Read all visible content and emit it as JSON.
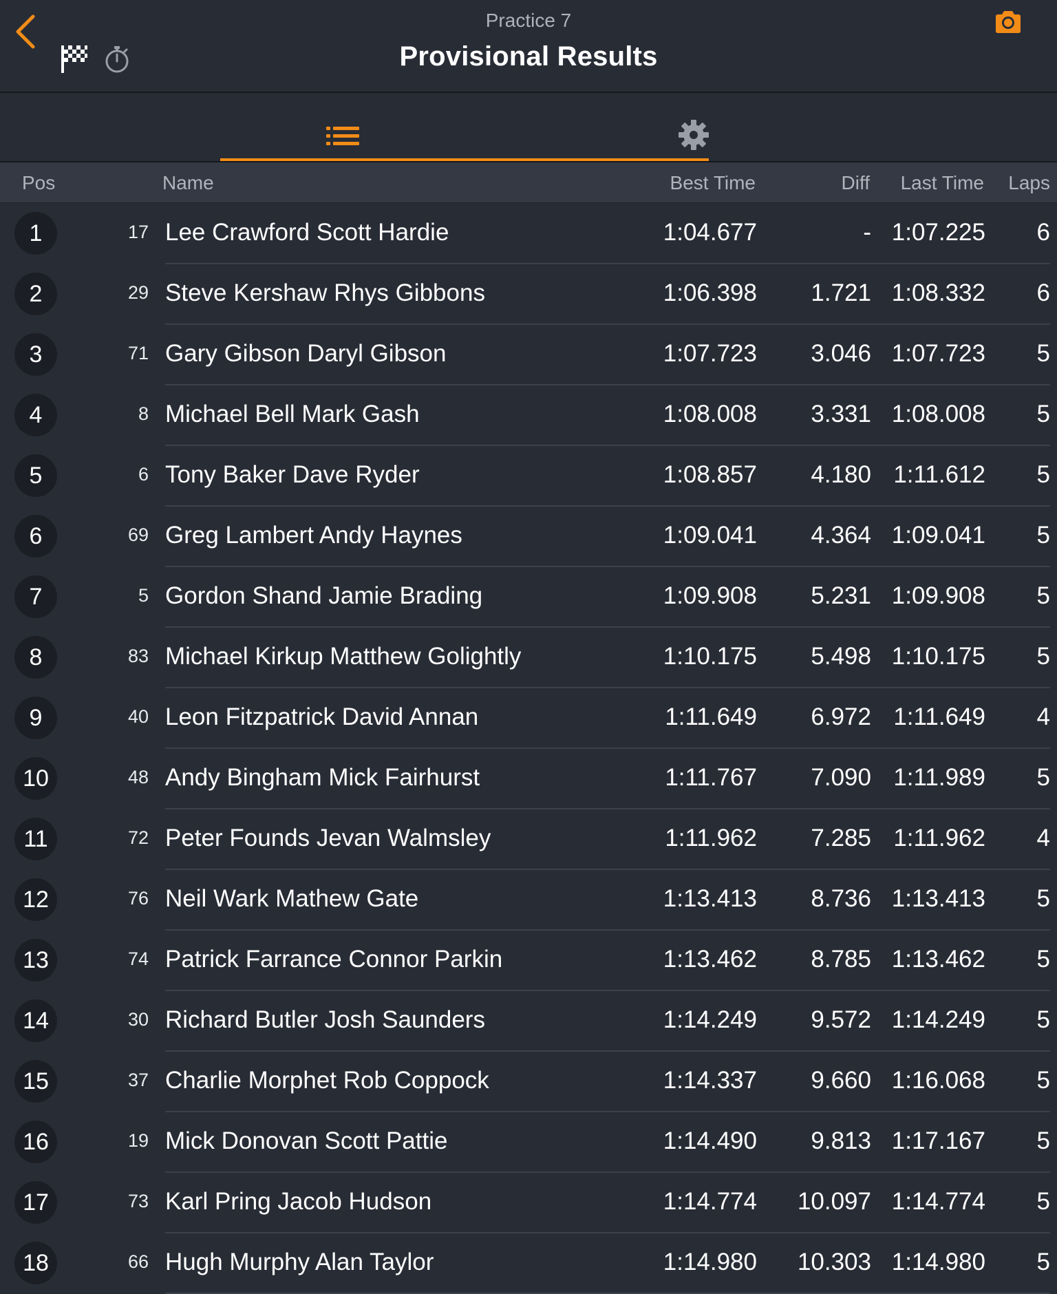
{
  "header": {
    "subtitle": "Practice 7",
    "title": "Provisional Results",
    "back_icon": "chevron-left-icon",
    "flag_icon": "checkered-flag-icon",
    "stopwatch_icon": "stopwatch-icon",
    "camera_icon": "camera-icon"
  },
  "tabs": [
    {
      "icon": "list-icon",
      "active": true
    },
    {
      "icon": "gear-icon",
      "active": false
    }
  ],
  "columns": {
    "pos": "Pos",
    "name": "Name",
    "best_time": "Best Time",
    "diff": "Diff",
    "last_time": "Last Time",
    "laps": "Laps"
  },
  "colors": {
    "accent": "#f28c17",
    "background": "#282c35",
    "header_row": "#343944",
    "badge": "#1b1e24"
  },
  "results": [
    {
      "pos": "1",
      "num": "17",
      "name": "Lee Crawford Scott Hardie",
      "best": "1:04.677",
      "diff": "-",
      "last": "1:07.225",
      "laps": "6"
    },
    {
      "pos": "2",
      "num": "29",
      "name": "Steve Kershaw Rhys Gibbons",
      "best": "1:06.398",
      "diff": "1.721",
      "last": "1:08.332",
      "laps": "6"
    },
    {
      "pos": "3",
      "num": "71",
      "name": "Gary Gibson Daryl Gibson",
      "best": "1:07.723",
      "diff": "3.046",
      "last": "1:07.723",
      "laps": "5"
    },
    {
      "pos": "4",
      "num": "8",
      "name": "Michael Bell Mark Gash",
      "best": "1:08.008",
      "diff": "3.331",
      "last": "1:08.008",
      "laps": "5"
    },
    {
      "pos": "5",
      "num": "6",
      "name": "Tony Baker Dave Ryder",
      "best": "1:08.857",
      "diff": "4.180",
      "last": "1:11.612",
      "laps": "5"
    },
    {
      "pos": "6",
      "num": "69",
      "name": "Greg Lambert Andy Haynes",
      "best": "1:09.041",
      "diff": "4.364",
      "last": "1:09.041",
      "laps": "5"
    },
    {
      "pos": "7",
      "num": "5",
      "name": "Gordon Shand Jamie Brading",
      "best": "1:09.908",
      "diff": "5.231",
      "last": "1:09.908",
      "laps": "5"
    },
    {
      "pos": "8",
      "num": "83",
      "name": "Michael Kirkup Matthew Golightly",
      "best": "1:10.175",
      "diff": "5.498",
      "last": "1:10.175",
      "laps": "5"
    },
    {
      "pos": "9",
      "num": "40",
      "name": "Leon Fitzpatrick David Annan",
      "best": "1:11.649",
      "diff": "6.972",
      "last": "1:11.649",
      "laps": "4"
    },
    {
      "pos": "10",
      "num": "48",
      "name": "Andy Bingham Mick Fairhurst",
      "best": "1:11.767",
      "diff": "7.090",
      "last": "1:11.989",
      "laps": "5"
    },
    {
      "pos": "11",
      "num": "72",
      "name": "Peter Founds Jevan Walmsley",
      "best": "1:11.962",
      "diff": "7.285",
      "last": "1:11.962",
      "laps": "4"
    },
    {
      "pos": "12",
      "num": "76",
      "name": "Neil Wark Mathew Gate",
      "best": "1:13.413",
      "diff": "8.736",
      "last": "1:13.413",
      "laps": "5"
    },
    {
      "pos": "13",
      "num": "74",
      "name": "Patrick Farrance Connor Parkin",
      "best": "1:13.462",
      "diff": "8.785",
      "last": "1:13.462",
      "laps": "5"
    },
    {
      "pos": "14",
      "num": "30",
      "name": "Richard Butler Josh Saunders",
      "best": "1:14.249",
      "diff": "9.572",
      "last": "1:14.249",
      "laps": "5"
    },
    {
      "pos": "15",
      "num": "37",
      "name": "Charlie Morphet Rob Coppock",
      "best": "1:14.337",
      "diff": "9.660",
      "last": "1:16.068",
      "laps": "5"
    },
    {
      "pos": "16",
      "num": "19",
      "name": "Mick Donovan Scott Pattie",
      "best": "1:14.490",
      "diff": "9.813",
      "last": "1:17.167",
      "laps": "5"
    },
    {
      "pos": "17",
      "num": "73",
      "name": "Karl Pring Jacob Hudson",
      "best": "1:14.774",
      "diff": "10.097",
      "last": "1:14.774",
      "laps": "5"
    },
    {
      "pos": "18",
      "num": "66",
      "name": "Hugh Murphy Alan Taylor",
      "best": "1:14.980",
      "diff": "10.303",
      "last": "1:14.980",
      "laps": "5"
    }
  ]
}
